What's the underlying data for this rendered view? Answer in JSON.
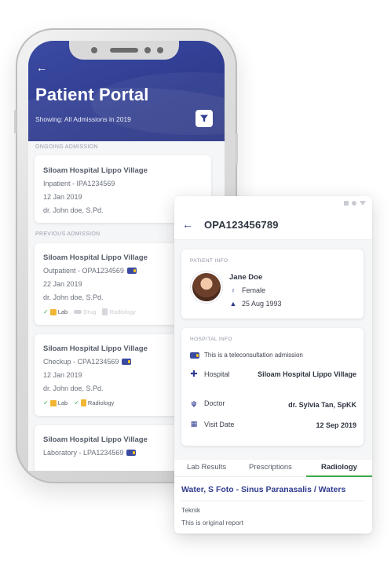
{
  "app": {
    "title": "Patient Portal",
    "showing": "Showing: All Admissions in 2019"
  },
  "sections": {
    "ongoing": "ONGOING ADMISSION",
    "previous": "PREVIOUS ADMISSION"
  },
  "ongoing": {
    "hospital": "Siloam Hospital Lippo Village",
    "type": "Inpatient - IPA1234569",
    "date": "12 Jan 2019",
    "doctor": "dr. John doe, S.Pd."
  },
  "previous": [
    {
      "hospital": "Siloam Hospital Lippo Village",
      "type": "Outpatient - OPA1234569",
      "date": "22 Jan 2019",
      "doctor": "dr. John doe, S.Pd.",
      "tests": [
        "Lab",
        "Drug",
        "Radiology"
      ]
    },
    {
      "hospital": "Siloam Hospital Lippo Village",
      "type": "Checkup - CPA1234569",
      "date": "12 Jan 2019",
      "doctor": "dr. John doe, S.Pd.",
      "tests": [
        "Lab",
        "Radiology"
      ]
    },
    {
      "hospital": "Siloam Hospital Lippo Village",
      "type": "Laboratory - LPA1234569"
    }
  ],
  "detail": {
    "id": "OPA123456789",
    "patient_label": "PATIENT INFO",
    "patient": {
      "name": "Jane Doe",
      "gender": "Female",
      "dob": "25 Aug 1993"
    },
    "hospital_label": "HOSPITAL INFO",
    "tele_note": "This is a teleconsultation admission",
    "hospital_key": "Hospital",
    "hospital_value": "Siloam Hospital Lippo Village",
    "doctor_key": "Doctor",
    "doctor_value": "dr. Sylvia Tan, SpKK",
    "visit_key": "Visit Date",
    "visit_value": "12 Sep 2019",
    "tabs": [
      "Lab Results",
      "Prescriptions",
      "Radiology"
    ],
    "active_tab": "Radiology",
    "report_title": "Water, S Foto - Sinus Paranasalis / Waters",
    "report_section": "Teknik",
    "report_text": "This is original report"
  },
  "colors": {
    "primary": "#2f3c8f",
    "accent_green": "#3caa4a",
    "badge_yellow": "#f6c21c"
  }
}
